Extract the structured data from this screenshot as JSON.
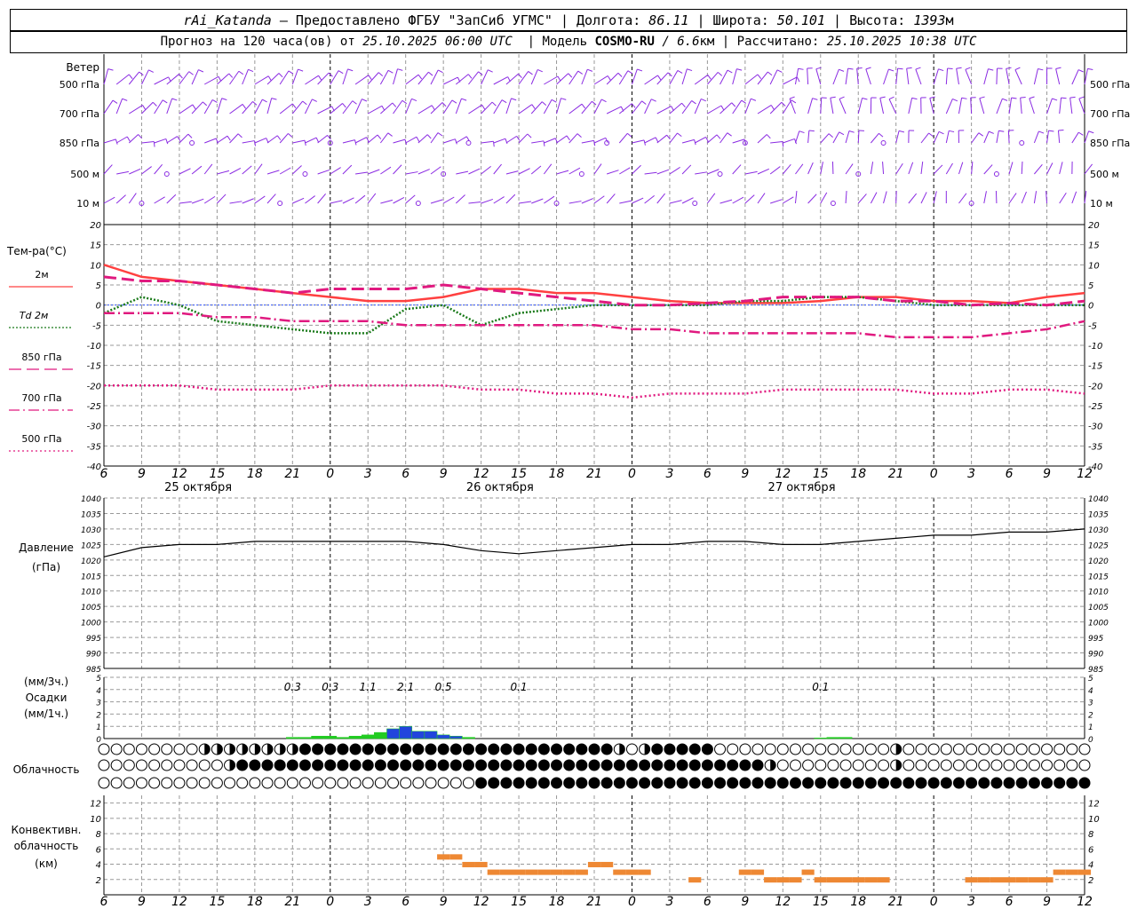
{
  "header": {
    "station": "rAi_Katanda",
    "provider": " — Предоставлено ФГБУ \"ЗапСиб УГМС\" | Долгота: ",
    "lon": "86.11",
    "lat_label": " | Широта: ",
    "lat": "50.101",
    "alt_label": " | Высота: ",
    "alt": "1393",
    "alt_unit": "м",
    "forecast_prefix": "Прогноз на 120 часа(ов) от ",
    "forecast_start": "25.10.2025 06:00 UTC",
    "model_prefix": "  | Модель ",
    "model": "COSMO-RU",
    "model_res": " / 6.6",
    "model_res_unit": "км",
    "calc_prefix": " | Рассчитано: ",
    "calc_time": "25.10.2025 10:38 UTC"
  },
  "colors": {
    "wind": "#8a2be2",
    "t2m": "#ff4040",
    "td2m": "#1a7a1a",
    "t850": "#e0197f",
    "t700": "#e0197f",
    "t500": "#e0197f",
    "pressure": "#000000",
    "precip_green": "#22cc22",
    "precip_blue": "#2244dd",
    "convective": "#ee8833",
    "grid": "#999999"
  },
  "panels": {
    "wind": {
      "title": "Ветер",
      "levels": [
        "500 гПа",
        "700 гПа",
        "850 гПа",
        "500 м",
        "10  м"
      ]
    },
    "temperature": {
      "title": "Тем-ра(°С)",
      "legend": [
        "2м",
        "Td 2м",
        "850 гПа",
        "700 гПа",
        "500 гПа"
      ],
      "ticks": [
        20,
        15,
        10,
        5,
        0,
        -5,
        -10,
        -15,
        -20,
        -25,
        -30,
        -35,
        -40
      ]
    },
    "pressure": {
      "title": "Давление",
      "unit": "(гПа)",
      "ticks": [
        1040,
        1035,
        1030,
        1025,
        1020,
        1015,
        1010,
        1005,
        1000,
        995,
        990,
        985
      ]
    },
    "precip": {
      "title_1": "(мм/3ч.)",
      "title_2": "Осадки",
      "title_3": "(мм/1ч.)",
      "ticks": [
        5,
        4,
        3,
        2,
        1,
        0
      ],
      "labels": [
        {
          "h": 15,
          "text": "0.3"
        },
        {
          "h": 18,
          "text": "0.3"
        },
        {
          "h": 21,
          "text": "1.1"
        },
        {
          "h": 24,
          "text": "2.1"
        },
        {
          "h": 27,
          "text": "0.5"
        },
        {
          "h": 33,
          "text": "0.1"
        },
        {
          "h": 57,
          "text": "0.1"
        }
      ]
    },
    "cloud": {
      "title": "Облачность"
    },
    "convective": {
      "title_1": "Конвективн.",
      "title_2": "облачность",
      "title_3": "(км)",
      "ticks": [
        12,
        10,
        8,
        6,
        4,
        2,
        0
      ]
    }
  },
  "time_axis": {
    "hour_labels": [
      "6",
      "9",
      "12",
      "15",
      "18",
      "21",
      "0",
      "3",
      "6",
      "9",
      "12",
      "15",
      "18",
      "21",
      "0",
      "3",
      "6",
      "9",
      "12",
      "15",
      "18",
      "21",
      "0",
      "3",
      "6",
      "9",
      "12"
    ],
    "dates": [
      {
        "h": 7.5,
        "label": "25 октября"
      },
      {
        "h": 31.5,
        "label": "26 октября"
      },
      {
        "h": 55.5,
        "label": "27 октября"
      }
    ]
  },
  "chart_data": [
    {
      "type": "line",
      "title": "Тем-ра(°С)",
      "ylim": [
        -40,
        20
      ],
      "x_unit": "hours from 25.10.2025 06:00 UTC",
      "x": [
        0,
        3,
        6,
        9,
        12,
        15,
        18,
        21,
        24,
        27,
        30,
        33,
        36,
        39,
        42,
        45,
        48,
        51,
        54,
        57,
        60,
        63,
        66,
        69,
        72,
        75,
        78
      ],
      "series": [
        {
          "name": "2м",
          "values": [
            10,
            7,
            6,
            5,
            4,
            3,
            2,
            1,
            1,
            2,
            4,
            4,
            3,
            3,
            2,
            1,
            0.5,
            0.5,
            0.5,
            1,
            2,
            2,
            1,
            1,
            0.5,
            2,
            3
          ]
        },
        {
          "name": "Td 2м",
          "values": [
            -2,
            2,
            0,
            -4,
            -5,
            -6,
            -7,
            -7,
            -1,
            0,
            -5,
            -2,
            -1,
            0,
            0,
            0,
            0,
            1,
            1,
            2,
            2,
            1,
            0,
            0,
            0,
            0,
            0
          ]
        },
        {
          "name": "850 гПа",
          "values": [
            7,
            6,
            6,
            5,
            4,
            3,
            4,
            4,
            4,
            5,
            4,
            3,
            2,
            1,
            0,
            0,
            0.5,
            1,
            2,
            2,
            2,
            1,
            1,
            0,
            0.5,
            0,
            1
          ]
        },
        {
          "name": "700 гПа",
          "values": [
            -2,
            -2,
            -2,
            -3,
            -3,
            -4,
            -4,
            -4,
            -5,
            -5,
            -5,
            -5,
            -5,
            -5,
            -6,
            -6,
            -7,
            -7,
            -7,
            -7,
            -7,
            -8,
            -8,
            -8,
            -7,
            -6,
            -4
          ]
        },
        {
          "name": "500 гПа",
          "values": [
            -20,
            -20,
            -20,
            -21,
            -21,
            -21,
            -20,
            -20,
            -20,
            -20,
            -21,
            -21,
            -22,
            -22,
            -23,
            -22,
            -22,
            -22,
            -21,
            -21,
            -21,
            -21,
            -22,
            -22,
            -21,
            -21,
            -22
          ]
        }
      ]
    },
    {
      "type": "line",
      "title": "Давление",
      "ylim": [
        985,
        1040
      ],
      "x": [
        0,
        3,
        6,
        9,
        12,
        15,
        18,
        21,
        24,
        27,
        30,
        33,
        36,
        39,
        42,
        45,
        48,
        51,
        54,
        57,
        60,
        63,
        66,
        69,
        72,
        75,
        78
      ],
      "series": [
        {
          "name": "Давление",
          "values": [
            1021,
            1024,
            1025,
            1025,
            1026,
            1026,
            1026,
            1026,
            1026,
            1025,
            1023,
            1022,
            1023,
            1024,
            1025,
            1025,
            1026,
            1026,
            1025,
            1025,
            1026,
            1027,
            1028,
            1028,
            1029,
            1029,
            1030
          ]
        }
      ]
    },
    {
      "type": "bar",
      "title": "Осадки",
      "ylim": [
        0,
        5
      ],
      "x_unit": "hours",
      "x": [
        15,
        16,
        17,
        18,
        19,
        20,
        21,
        22,
        23,
        24,
        25,
        26,
        27,
        28,
        29,
        57,
        58,
        59
      ],
      "series": [
        {
          "name": "мм/1ч.",
          "values": [
            0.1,
            0.1,
            0.2,
            0.2,
            0.1,
            0.2,
            0.3,
            0.5,
            0.8,
            1.0,
            0.6,
            0.6,
            0.3,
            0.2,
            0.1,
            0.05,
            0.1,
            0.1
          ]
        }
      ]
    },
    {
      "type": "bar",
      "title": "Конвективн. облачность",
      "ylim": [
        0,
        12
      ],
      "x": [
        27,
        28,
        29,
        30,
        31,
        32,
        33,
        34,
        35,
        36,
        37,
        38,
        39,
        40,
        41,
        42,
        43,
        47,
        51,
        52,
        53,
        54,
        55,
        56,
        57,
        58,
        59,
        60,
        61,
        62,
        69,
        70,
        71,
        72,
        73,
        74,
        75,
        76,
        77,
        78
      ],
      "series": [
        {
          "name": "km",
          "values": [
            5,
            5,
            4,
            4,
            3,
            3,
            3,
            3,
            3,
            3,
            3,
            3,
            4,
            4,
            3,
            3,
            3,
            2,
            3,
            3,
            2,
            2,
            2,
            3,
            2,
            2,
            2,
            2,
            2,
            2,
            2,
            2,
            2,
            2,
            2,
            2,
            2,
            3,
            3,
            3
          ]
        }
      ]
    }
  ]
}
